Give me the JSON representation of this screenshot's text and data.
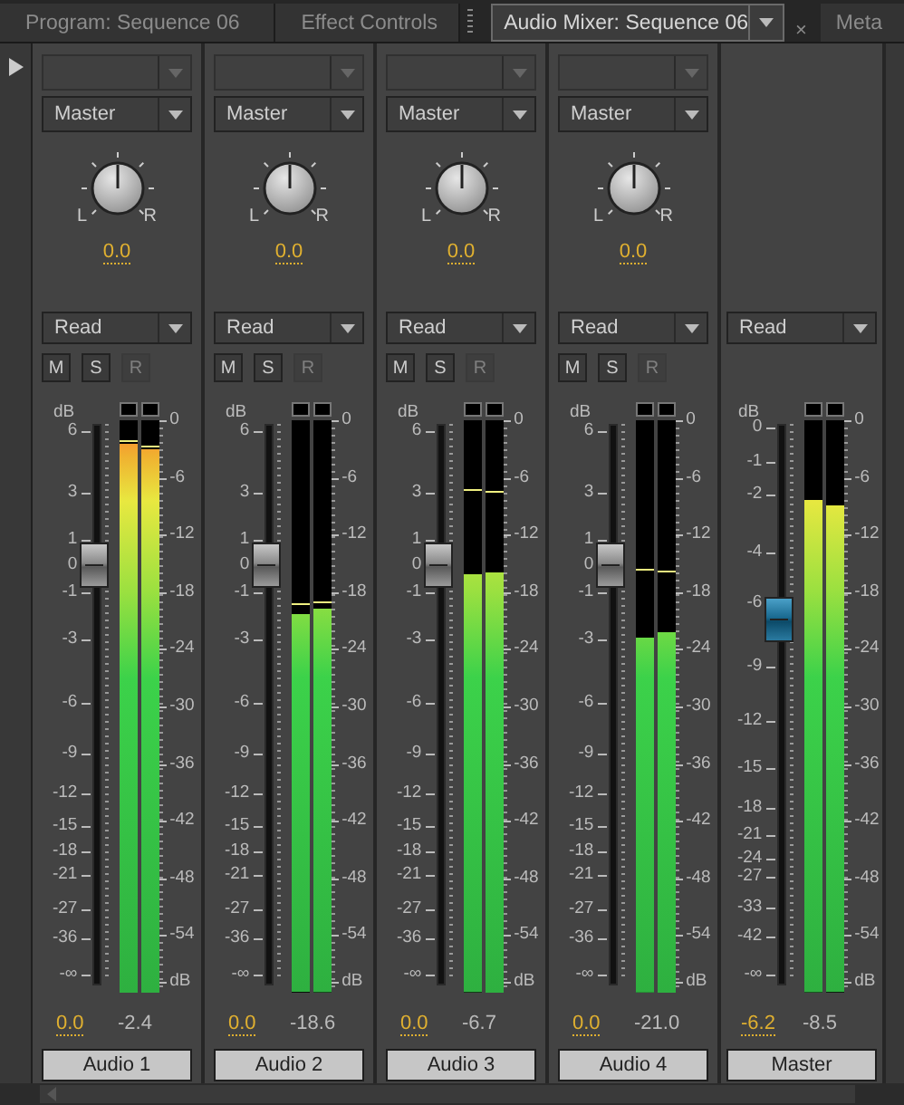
{
  "tabs": [
    {
      "label": "Program: Sequence 06",
      "selected": false
    },
    {
      "label": "Effect Controls",
      "selected": false
    },
    {
      "label": "Audio Mixer: Sequence 06",
      "selected": true,
      "close": "×"
    },
    {
      "label": "Meta",
      "selected": false
    }
  ],
  "channels": [
    {
      "kind": "track",
      "output": "Master",
      "pan_labels": [
        "L",
        "R"
      ],
      "pan_value": "0.0",
      "automation": "Read",
      "buttons": [
        {
          "label": "M",
          "disabled": false
        },
        {
          "label": "S",
          "disabled": false
        },
        {
          "label": "R",
          "disabled": true
        }
      ],
      "fader_unit": "dB",
      "fader_scale": [
        "6",
        "3",
        "1",
        "0",
        "-1",
        "-3",
        "-6",
        "-9",
        "-12",
        "-15",
        "-18",
        "-21",
        "-27",
        "-36",
        "-∞"
      ],
      "fader": {
        "level": 0.747
      },
      "meters": [
        {
          "level": 0.96,
          "peak_hold": {
            "level": 0.965
          }
        },
        {
          "level": 0.95,
          "peak_hold": {
            "level": 0.955
          }
        }
      ],
      "meter_scale": [
        "0",
        "-6",
        "-12",
        "-18",
        "-24",
        "-30",
        "-36",
        "-42",
        "-48",
        "-54"
      ],
      "meter_unit": "dB",
      "fader_value": "0.0",
      "peak_value": "-2.4",
      "name": "Audio 1"
    },
    {
      "kind": "track",
      "output": "Master",
      "pan_labels": [
        "L",
        "R"
      ],
      "pan_value": "0.0",
      "automation": "Read",
      "buttons": [
        {
          "label": "M",
          "disabled": false
        },
        {
          "label": "S",
          "disabled": false
        },
        {
          "label": "R",
          "disabled": true
        }
      ],
      "fader_unit": "dB",
      "fader_scale": [
        "6",
        "3",
        "1",
        "0",
        "-1",
        "-3",
        "-6",
        "-9",
        "-12",
        "-15",
        "-18",
        "-21",
        "-27",
        "-36",
        "-∞"
      ],
      "fader": {
        "level": 0.747
      },
      "meters": [
        {
          "level": 0.66,
          "peak_hold": {
            "level": 0.68
          }
        },
        {
          "level": 0.67,
          "peak_hold": {
            "level": 0.685
          }
        }
      ],
      "meter_scale": [
        "0",
        "-6",
        "-12",
        "-18",
        "-24",
        "-30",
        "-36",
        "-42",
        "-48",
        "-54"
      ],
      "meter_unit": "dB",
      "fader_value": "0.0",
      "peak_value": "-18.6",
      "name": "Audio 2"
    },
    {
      "kind": "track",
      "output": "Master",
      "pan_labels": [
        "L",
        "R"
      ],
      "pan_value": "0.0",
      "automation": "Read",
      "buttons": [
        {
          "label": "M",
          "disabled": false
        },
        {
          "label": "S",
          "disabled": false
        },
        {
          "label": "R",
          "disabled": true
        }
      ],
      "fader_unit": "dB",
      "fader_scale": [
        "6",
        "3",
        "1",
        "0",
        "-1",
        "-3",
        "-6",
        "-9",
        "-12",
        "-15",
        "-18",
        "-21",
        "-27",
        "-36",
        "-∞"
      ],
      "fader": {
        "level": 0.747
      },
      "meters": [
        {
          "level": 0.73,
          "peak_hold": {
            "level": 0.88
          }
        },
        {
          "level": 0.735,
          "peak_hold": {
            "level": 0.877
          }
        }
      ],
      "meter_scale": [
        "0",
        "-6",
        "-12",
        "-18",
        "-24",
        "-30",
        "-36",
        "-42",
        "-48",
        "-54"
      ],
      "meter_unit": "dB",
      "fader_value": "0.0",
      "peak_value": "-6.7",
      "name": "Audio 3"
    },
    {
      "kind": "track",
      "output": "Master",
      "pan_labels": [
        "L",
        "R"
      ],
      "pan_value": "0.0",
      "automation": "Read",
      "buttons": [
        {
          "label": "M",
          "disabled": false
        },
        {
          "label": "S",
          "disabled": false
        },
        {
          "label": "R",
          "disabled": true
        }
      ],
      "fader_unit": "dB",
      "fader_scale": [
        "6",
        "3",
        "1",
        "0",
        "-1",
        "-3",
        "-6",
        "-9",
        "-12",
        "-15",
        "-18",
        "-21",
        "-27",
        "-36",
        "-∞"
      ],
      "fader": {
        "level": 0.747
      },
      "meters": [
        {
          "level": 0.62,
          "peak_hold": {
            "level": 0.74
          }
        },
        {
          "level": 0.63,
          "peak_hold": {
            "level": 0.737
          }
        }
      ],
      "meter_scale": [
        "0",
        "-6",
        "-12",
        "-18",
        "-24",
        "-30",
        "-36",
        "-42",
        "-48",
        "-54"
      ],
      "meter_unit": "dB",
      "fader_value": "0.0",
      "peak_value": "-21.0",
      "name": "Audio 4"
    },
    {
      "kind": "master",
      "automation": "Read",
      "fader_unit": "dB",
      "fader_scale": [
        "0",
        "-1",
        "-2",
        "-4",
        "-6",
        "-9",
        "-12",
        "-15",
        "-18",
        "-21",
        "-24",
        "-27",
        "-33",
        "-42",
        "-∞"
      ],
      "fader": {
        "level": 0.649
      },
      "meters": [
        {
          "level": 0.86
        },
        {
          "level": 0.85
        }
      ],
      "meter_scale": [
        "0",
        "-6",
        "-12",
        "-18",
        "-24",
        "-30",
        "-36",
        "-42",
        "-48",
        "-54"
      ],
      "meter_unit": "dB",
      "fader_value": "-6.2",
      "peak_value": "-8.5",
      "name": "Master"
    }
  ]
}
